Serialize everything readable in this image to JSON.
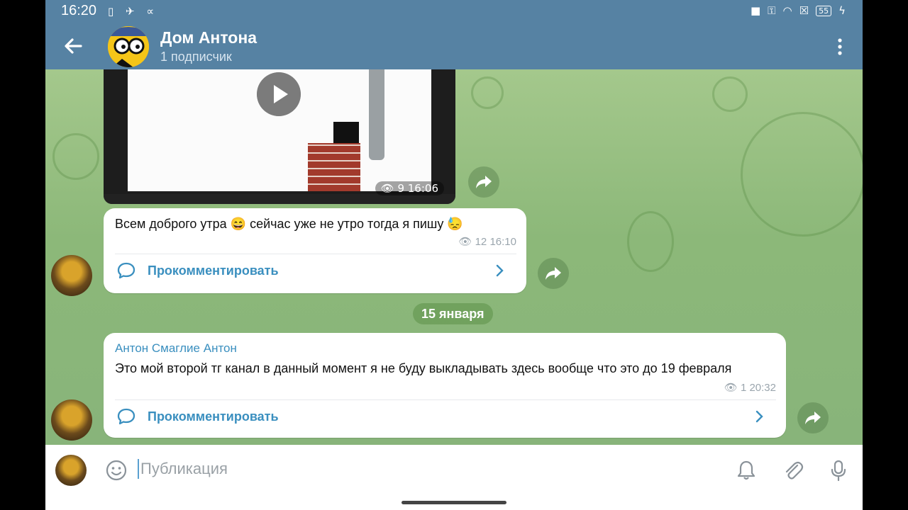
{
  "status_bar": {
    "time": "16:20",
    "battery": "55"
  },
  "header": {
    "title": "Дом Антона",
    "subtitle": "1 подписчик"
  },
  "messages": [
    {
      "type": "video",
      "views": "9",
      "time": "16:06"
    },
    {
      "type": "text",
      "text": "Всем доброго утра 😄 сейчас уже не утро тогда я пишу 😓",
      "views": "12",
      "time": "16:10",
      "comment_label": "Прокомментировать"
    },
    {
      "type": "text",
      "author": "Антон Смаглие Антон",
      "text": "Это мой второй тг канал в данный момент я не буду выкладывать здесь вообще что это до 19 февраля",
      "views": "1",
      "time": "20:32",
      "comment_label": "Прокомментировать"
    }
  ],
  "date_divider": "15 января",
  "composer": {
    "placeholder": "Публикация"
  },
  "colors": {
    "header": "#5682a3",
    "link": "#3a8fbf",
    "chat_bg": "#8fb97a"
  },
  "icons": {
    "back": "arrow-left-icon",
    "menu": "kebab-menu-icon",
    "emoji": "smiley-icon",
    "bell": "bell-icon",
    "attach": "paperclip-icon",
    "mic": "microphone-icon",
    "share": "share-arrow-icon",
    "comment": "chat-bubble-icon",
    "eye": "eye-icon"
  }
}
